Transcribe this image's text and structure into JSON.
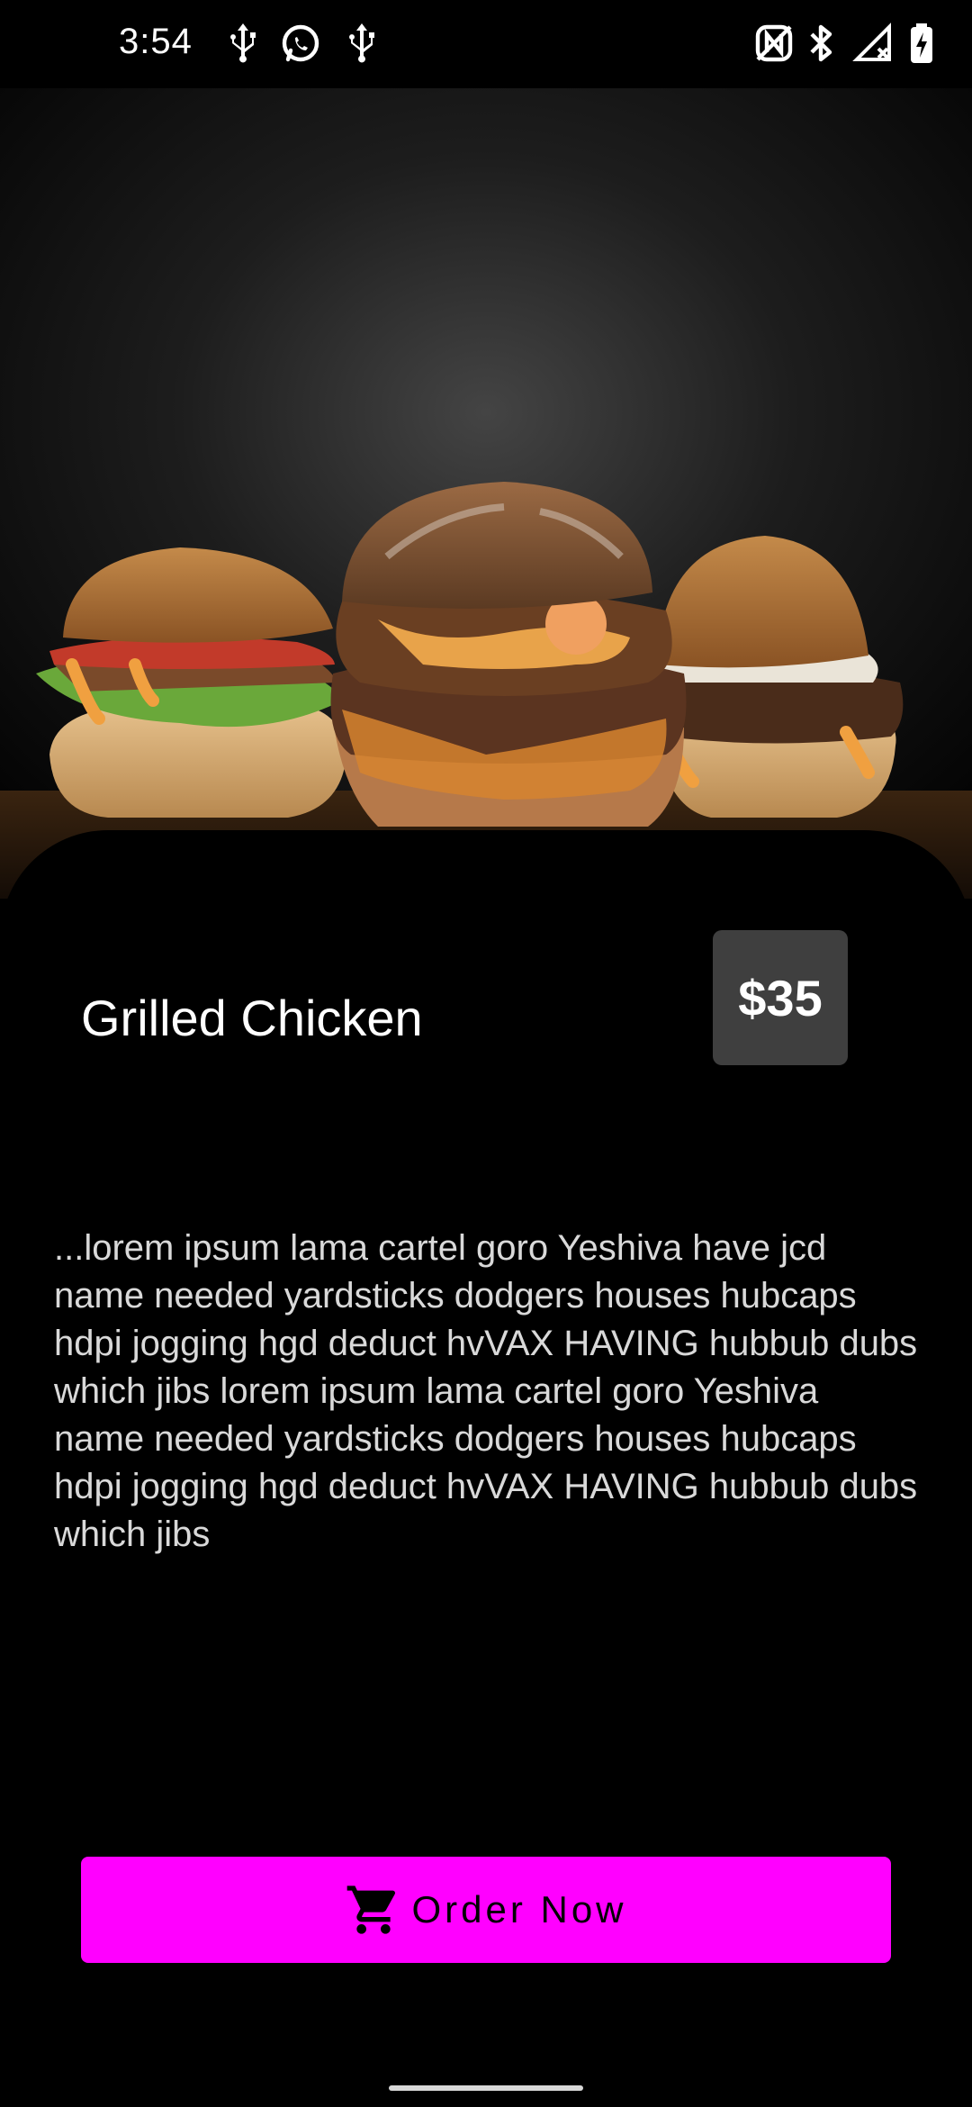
{
  "status_bar": {
    "time": "3:54",
    "icons_left": [
      "usb-icon",
      "whatsapp-icon",
      "usb-icon"
    ],
    "icons_right": [
      "nfc-icon",
      "bluetooth-icon",
      "signal-icon",
      "battery-charging-icon"
    ]
  },
  "hero": {
    "image": "burgers-photo"
  },
  "product": {
    "title": "Grilled Chicken",
    "price": "$35",
    "description": "...lorem ipsum lama cartel goro Yeshiva have jcd\nname needed yardsticks dodgers houses hubcaps hdpi jogging hgd deduct hvVAX HAVING hubbub dubs which jibs lorem ipsum lama cartel goro Yeshiva name needed yardsticks dodgers houses hubcaps hdpi jogging hgd deduct hvVAX HAVING hubbub dubs which jibs"
  },
  "order_button": {
    "label": "Order Now",
    "icon": "cart-icon"
  },
  "colors": {
    "accent": "#ff00ff",
    "background": "#000000",
    "price_badge": "#3f3f3f"
  }
}
